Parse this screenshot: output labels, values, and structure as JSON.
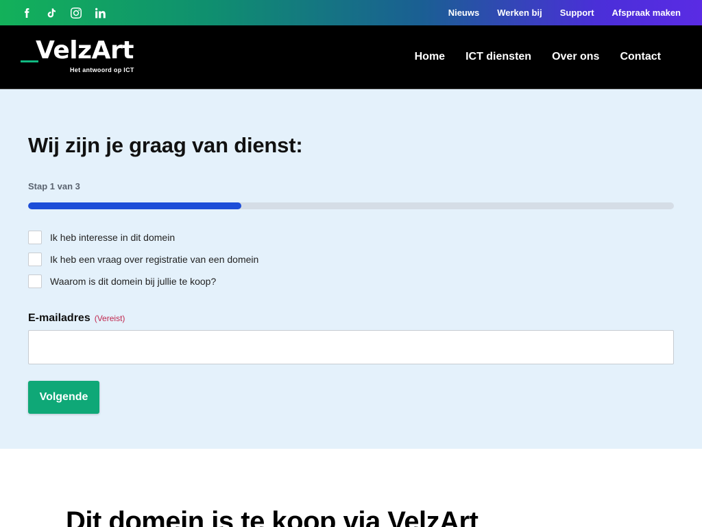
{
  "topbar": {
    "socials": [
      {
        "icon": "facebook-icon"
      },
      {
        "icon": "tiktok-icon"
      },
      {
        "icon": "instagram-icon"
      },
      {
        "icon": "linkedin-icon"
      }
    ],
    "links": [
      "Nieuws",
      "Werken bij",
      "Support",
      "Afspraak maken"
    ]
  },
  "header": {
    "logo_word": "VelzArt",
    "logo_tagline": "Het antwoord op ICT",
    "nav": [
      "Home",
      "ICT diensten",
      "Over ons",
      "Contact"
    ]
  },
  "form": {
    "title": "Wij zijn je graag van dienst:",
    "step": "Stap 1 van 3",
    "progress_fraction": 0.33,
    "options": [
      "Ik heb interesse in dit domein",
      "Ik heb een vraag over registratie van een domein",
      "Waarom is dit domein bij jullie te koop?"
    ],
    "email_label": "E-mailadres",
    "email_required": "(Vereist)",
    "email_value": "",
    "next_button": "Volgende"
  },
  "bottom": {
    "heading": "Dit domein is te koop via VelzArt"
  },
  "colors": {
    "accent_green": "#0fa877",
    "progress_blue": "#1d4ed8",
    "form_bg": "#e4f1fb"
  }
}
